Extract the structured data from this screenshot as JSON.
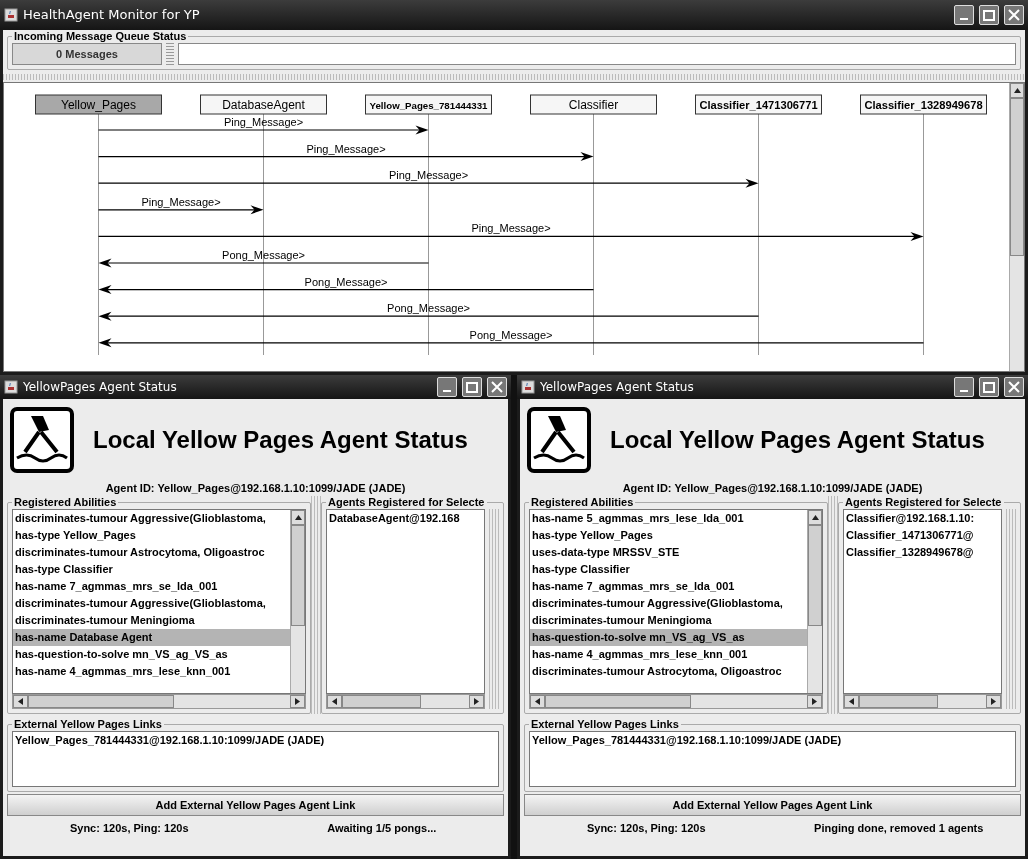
{
  "main_window": {
    "title": "HealthAgent Monitor for YP",
    "queue": {
      "legend": "Incoming Message Queue Status",
      "count": "0 Messages"
    },
    "sequence": {
      "lifelines": [
        {
          "name": "Yellow_Pages",
          "selected": true
        },
        {
          "name": "DatabaseAgent",
          "selected": false
        },
        {
          "name": "Yellow_Pages_781444331",
          "selected": false
        },
        {
          "name": "Classifier",
          "selected": false
        },
        {
          "name": "Classifier_1471306771",
          "selected": false
        },
        {
          "name": "Classifier_1328949678",
          "selected": false
        }
      ],
      "messages": [
        {
          "kind": "rightward",
          "label": "Ping_Message>",
          "ends": [
            true,
            false,
            true,
            false,
            false,
            false
          ]
        },
        {
          "kind": "rightward",
          "label": "Ping_Message>",
          "ends": [
            true,
            false,
            false,
            true,
            false,
            false
          ]
        },
        {
          "kind": "rightward",
          "label": "Ping_Message>",
          "ends": [
            true,
            false,
            false,
            false,
            true,
            false
          ]
        },
        {
          "kind": "rightward",
          "label": "Ping_Message>",
          "ends": [
            true,
            true,
            false,
            false,
            false,
            false
          ]
        },
        {
          "kind": "rightward",
          "label": "Ping_Message>",
          "ends": [
            true,
            false,
            false,
            false,
            false,
            true
          ]
        },
        {
          "kind": "leftward",
          "label": "Pong_Message>",
          "ends": [
            true,
            false,
            true,
            false,
            false,
            false
          ]
        },
        {
          "kind": "leftward",
          "label": "Pong_Message>",
          "ends": [
            true,
            false,
            false,
            true,
            false,
            false
          ]
        },
        {
          "kind": "leftward",
          "label": "Pong_Message>",
          "ends": [
            true,
            false,
            false,
            false,
            true,
            false
          ]
        },
        {
          "kind": "leftward",
          "label": "Pong_Message>",
          "ends": [
            true,
            false,
            false,
            false,
            false,
            true
          ]
        }
      ]
    }
  },
  "agent_windows": [
    {
      "title": "YellowPages Agent Status",
      "heading": "Local Yellow Pages Agent Status",
      "agent_id": "Agent ID: Yellow_Pages@192.168.1.10:1099/JADE (JADE)",
      "abilities_legend": "Registered Abilities",
      "abilities": [
        {
          "text": "discriminates-tumour Aggressive(Glioblastoma,",
          "selected": false
        },
        {
          "text": "has-type Yellow_Pages",
          "selected": false
        },
        {
          "text": "discriminates-tumour Astrocytoma, Oligoastroc",
          "selected": false
        },
        {
          "text": "has-type Classifier",
          "selected": false
        },
        {
          "text": "has-name 7_agmmas_mrs_se_lda_001",
          "selected": false
        },
        {
          "text": "discriminates-tumour Aggressive(Glioblastoma,",
          "selected": false
        },
        {
          "text": "discriminates-tumour Meningioma",
          "selected": false
        },
        {
          "text": "has-name Database Agent",
          "selected": true
        },
        {
          "text": "has-question-to-solve mn_VS_ag_VS_as",
          "selected": false
        },
        {
          "text": "has-name 4_agmmas_mrs_lese_knn_001",
          "selected": false
        }
      ],
      "agents_legend": "Agents Registered for Selecte",
      "agents": [
        "DatabaseAgent@192.168"
      ],
      "links_legend": "External Yellow Pages Links",
      "links": [
        "Yellow_Pages_781444331@192.168.1.10:1099/JADE (JADE)"
      ],
      "add_button": "Add External Yellow Pages Agent Link",
      "status_left": "Sync: 120s, Ping: 120s",
      "status_right": "Awaiting 1/5 pongs..."
    },
    {
      "title": "YellowPages Agent Status",
      "heading": "Local Yellow Pages Agent Status",
      "agent_id": "Agent ID: Yellow_Pages@192.168.1.10:1099/JADE (JADE)",
      "abilities_legend": "Registered Abilities",
      "abilities": [
        {
          "text": "has-name 5_agmmas_mrs_lese_lda_001",
          "selected": false
        },
        {
          "text": "has-type Yellow_Pages",
          "selected": false
        },
        {
          "text": "uses-data-type MRSSV_STE",
          "selected": false
        },
        {
          "text": "has-type Classifier",
          "selected": false
        },
        {
          "text": "has-name 7_agmmas_mrs_se_lda_001",
          "selected": false
        },
        {
          "text": "discriminates-tumour Aggressive(Glioblastoma,",
          "selected": false
        },
        {
          "text": "discriminates-tumour Meningioma",
          "selected": false
        },
        {
          "text": "has-question-to-solve mn_VS_ag_VS_as",
          "selected": true
        },
        {
          "text": "has-name 4_agmmas_mrs_lese_knn_001",
          "selected": false
        },
        {
          "text": "discriminates-tumour Astrocytoma, Oligoastroc",
          "selected": false
        }
      ],
      "agents_legend": "Agents Registered for Selecte",
      "agents": [
        "Classifier@192.168.1.10:",
        "Classifier_1471306771@",
        "Classifier_1328949678@"
      ],
      "links_legend": "External Yellow Pages Links",
      "links": [
        "Yellow_Pages_781444331@192.168.1.10:1099/JADE (JADE)"
      ],
      "add_button": "Add External Yellow Pages Agent Link",
      "status_left": "Sync: 120s, Ping: 120s",
      "status_right": "Pinging done, removed 1 agents"
    }
  ]
}
